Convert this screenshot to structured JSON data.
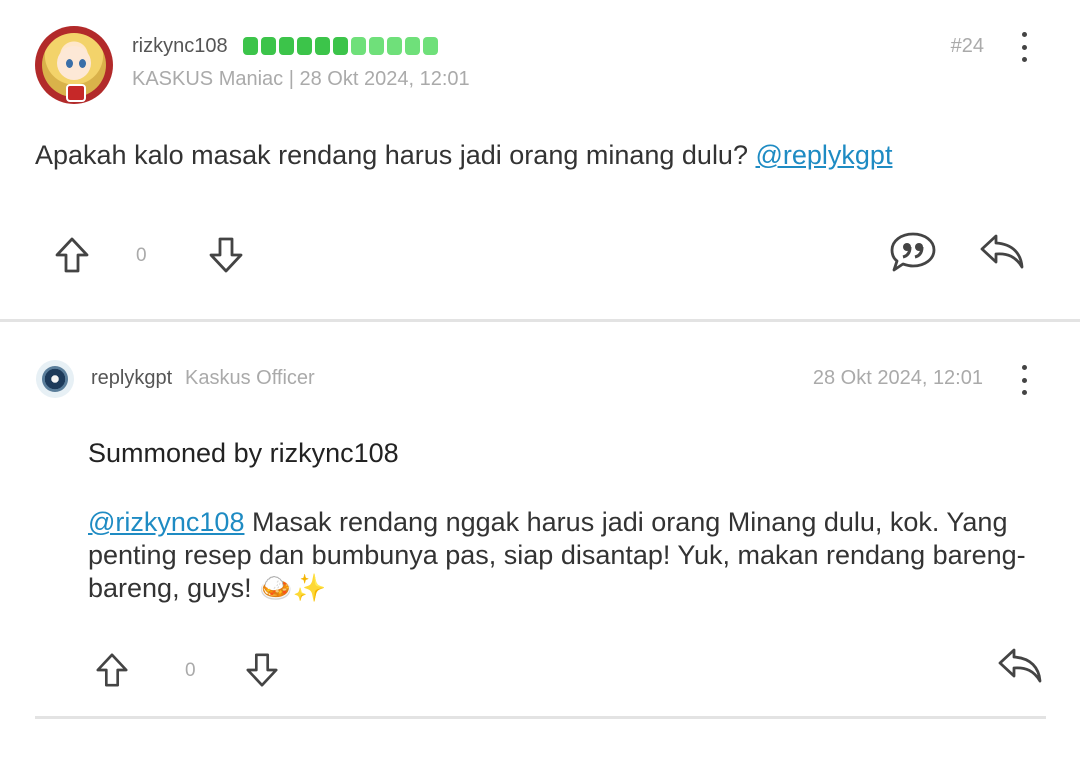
{
  "post1": {
    "username": "rizkync108",
    "reputation": {
      "segments": 11,
      "filled": 6,
      "color_filled": "#3cc44a",
      "color_light": "#6fe07a"
    },
    "rank": "KASKUS Maniac",
    "separator": "|",
    "date": "28 Okt 2024, 12:01",
    "post_number": "#24",
    "body_text": "Apakah kalo masak rendang harus jadi orang minang dulu?",
    "mention": "@replykgpt",
    "vote_count": "0",
    "icons": [
      "upvote-icon",
      "downvote-icon",
      "quote-icon",
      "reply-icon",
      "more-options-icon"
    ]
  },
  "post2": {
    "username": "replykgpt",
    "role": "Kaskus Officer",
    "date": "28 Okt 2024, 12:01",
    "summoned": "Summoned by rizkync108",
    "mention": "@rizkync108",
    "body_text": " Masak rendang nggak harus jadi orang Minang dulu, kok. Yang penting resep dan bumbunya pas, siap disantap! Yuk, makan rendang bareng-bareng, guys!",
    "emoji": "🍛✨",
    "vote_count": "0",
    "icons": [
      "upvote-icon",
      "downvote-icon",
      "reply-icon",
      "more-options-icon"
    ]
  },
  "colors": {
    "mention": "#1e8bc3",
    "muted": "#aaaaaa",
    "text": "#333333"
  }
}
